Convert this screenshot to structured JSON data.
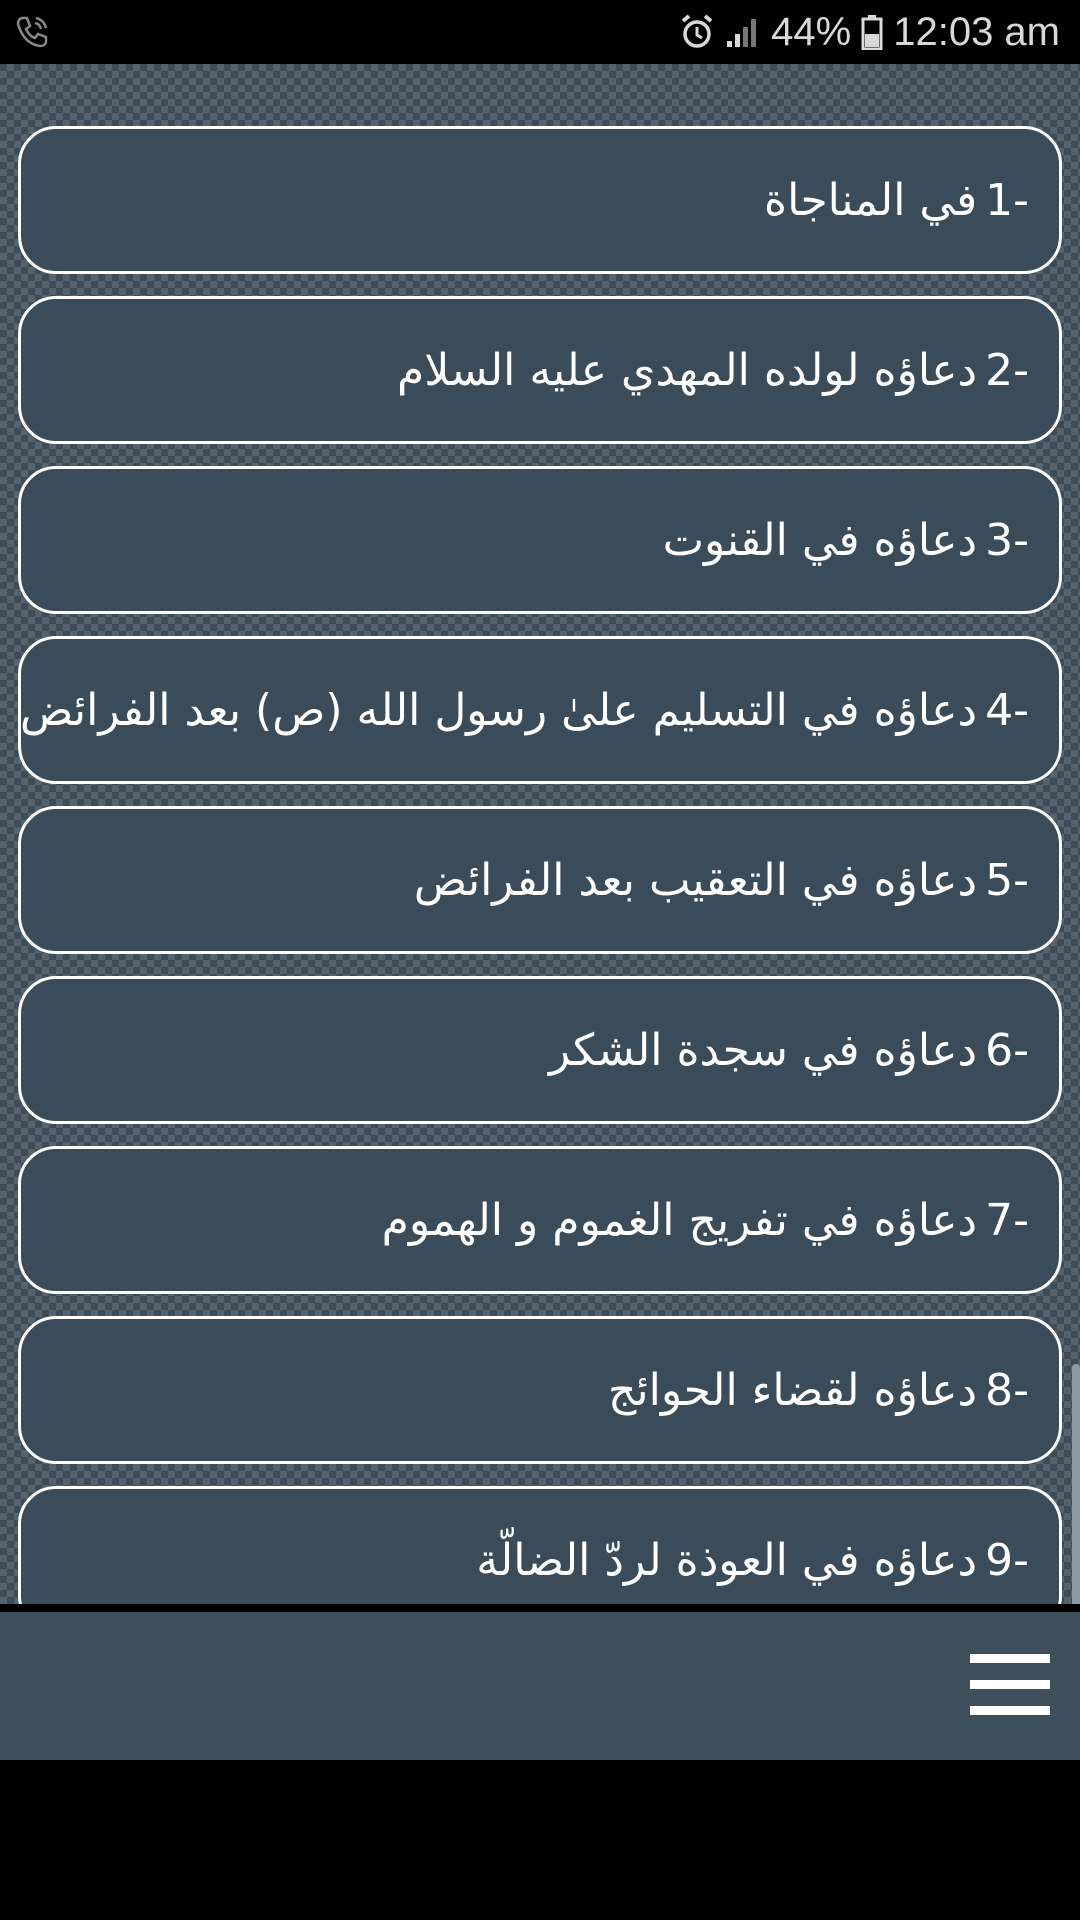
{
  "status_bar": {
    "battery": "44%",
    "time": "12:03 am"
  },
  "items": [
    {
      "num": "1-",
      "label": "في المناجاة"
    },
    {
      "num": "2-",
      "label": "دعاؤه لولده المهدي عليه السلام"
    },
    {
      "num": "3-",
      "label": "دعاؤه في القنوت"
    },
    {
      "num": "4-",
      "label": "دعاؤه في التسليم علىٰ رسول الله (ص) بعد الفرائض"
    },
    {
      "num": "5-",
      "label": "دعاؤه في التعقيب بعد الفرائض"
    },
    {
      "num": "6-",
      "label": "دعاؤه في سجدة الشكر"
    },
    {
      "num": "7-",
      "label": "دعاؤه في تفريج الغموم و الهموم"
    },
    {
      "num": "8-",
      "label": "دعاؤه لقضاء الحوائج"
    },
    {
      "num": "9-",
      "label": "دعاؤه في العوذة لردّ الضالّة"
    }
  ],
  "icons": {
    "status_left": "phone-icon",
    "alarm": "alarm-icon",
    "signal": "signal-icon",
    "battery": "battery-icon",
    "menu": "hamburger-menu-icon"
  }
}
